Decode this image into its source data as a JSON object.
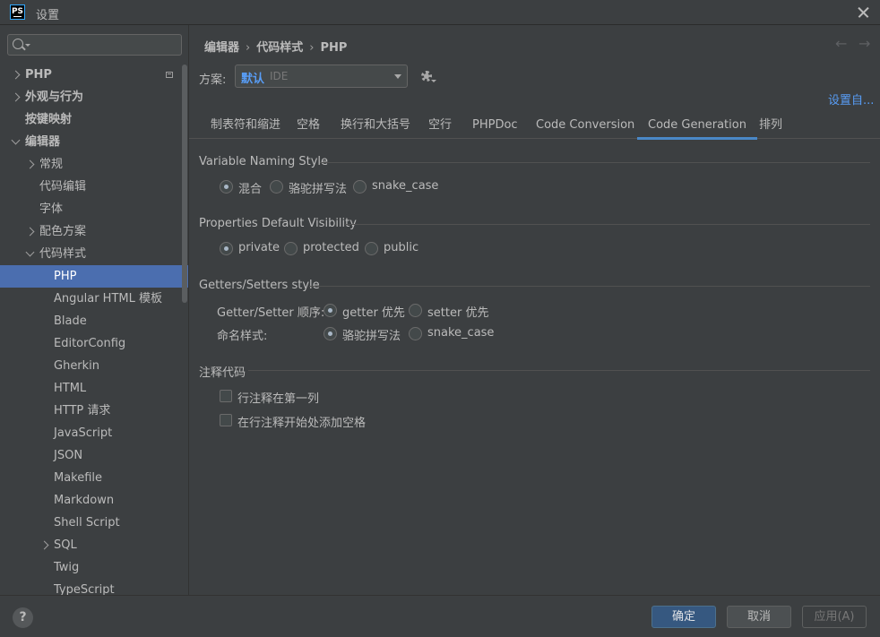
{
  "window": {
    "title": "设置",
    "logo_text": "PS"
  },
  "search": {
    "placeholder": "",
    "value": ""
  },
  "sidebar": {
    "items": [
      {
        "label": "PHP",
        "level": 0,
        "arrow": "right",
        "bold": true,
        "badge": true
      },
      {
        "label": "外观与行为",
        "level": 0,
        "arrow": "right",
        "bold": true
      },
      {
        "label": "按键映射",
        "level": 0,
        "arrow": "",
        "bold": true
      },
      {
        "label": "编辑器",
        "level": 0,
        "arrow": "down",
        "bold": true
      },
      {
        "label": "常规",
        "level": 1,
        "arrow": "right"
      },
      {
        "label": "代码编辑",
        "level": 1,
        "arrow": ""
      },
      {
        "label": "字体",
        "level": 1,
        "arrow": ""
      },
      {
        "label": "配色方案",
        "level": 1,
        "arrow": "right"
      },
      {
        "label": "代码样式",
        "level": 1,
        "arrow": "down"
      },
      {
        "label": "PHP",
        "level": 2,
        "arrow": "",
        "selected": true
      },
      {
        "label": "Angular HTML 模板",
        "level": 2,
        "arrow": ""
      },
      {
        "label": "Blade",
        "level": 2,
        "arrow": ""
      },
      {
        "label": "EditorConfig",
        "level": 2,
        "arrow": ""
      },
      {
        "label": "Gherkin",
        "level": 2,
        "arrow": ""
      },
      {
        "label": "HTML",
        "level": 2,
        "arrow": ""
      },
      {
        "label": "HTTP 请求",
        "level": 2,
        "arrow": ""
      },
      {
        "label": "JavaScript",
        "level": 2,
        "arrow": ""
      },
      {
        "label": "JSON",
        "level": 2,
        "arrow": ""
      },
      {
        "label": "Makefile",
        "level": 2,
        "arrow": ""
      },
      {
        "label": "Markdown",
        "level": 2,
        "arrow": ""
      },
      {
        "label": "Shell Script",
        "level": 2,
        "arrow": ""
      },
      {
        "label": "SQL",
        "level": 2,
        "arrow": "right"
      },
      {
        "label": "Twig",
        "level": 2,
        "arrow": ""
      },
      {
        "label": "TypeScript",
        "level": 2,
        "arrow": ""
      }
    ]
  },
  "breadcrumb": {
    "items": [
      "编辑器",
      "代码样式",
      "PHP"
    ],
    "separator": "›"
  },
  "nav": {
    "back": "←",
    "forward": "→"
  },
  "scheme": {
    "label": "方案:",
    "value": "默认",
    "sub": "IDE",
    "set_from": "设置自..."
  },
  "tabs": [
    {
      "label": "制表符和缩进"
    },
    {
      "label": "空格"
    },
    {
      "label": "换行和大括号"
    },
    {
      "label": "空行"
    },
    {
      "label": "PHPDoc"
    },
    {
      "label": "Code Conversion"
    },
    {
      "label": "Code Generation",
      "active": true
    },
    {
      "label": "排列"
    }
  ],
  "sections": {
    "naming": {
      "title": "Variable Naming Style",
      "options": [
        {
          "label": "混合",
          "checked": true
        },
        {
          "label": "骆驼拼写法",
          "checked": false
        },
        {
          "label": "snake_case",
          "checked": false
        }
      ]
    },
    "visibility": {
      "title": "Properties Default Visibility",
      "options": [
        {
          "label": "private",
          "checked": true
        },
        {
          "label": "protected",
          "checked": false
        },
        {
          "label": "public",
          "checked": false
        }
      ]
    },
    "getters": {
      "title": "Getters/Setters style",
      "order_label": "Getter/Setter 顺序:",
      "order_options": [
        {
          "label": "getter 优先",
          "checked": true
        },
        {
          "label": "setter 优先",
          "checked": false
        }
      ],
      "naming_label": "命名样式:",
      "naming_options": [
        {
          "label": "骆驼拼写法",
          "checked": true
        },
        {
          "label": "snake_case",
          "checked": false
        }
      ]
    },
    "comment": {
      "title": "注释代码",
      "checkboxes": [
        {
          "label": "行注释在第一列",
          "checked": false
        },
        {
          "label": "在行注释开始处添加空格",
          "checked": false
        }
      ]
    }
  },
  "footer": {
    "help": "?",
    "ok": "确定",
    "cancel": "取消",
    "apply": "应用(A)"
  }
}
